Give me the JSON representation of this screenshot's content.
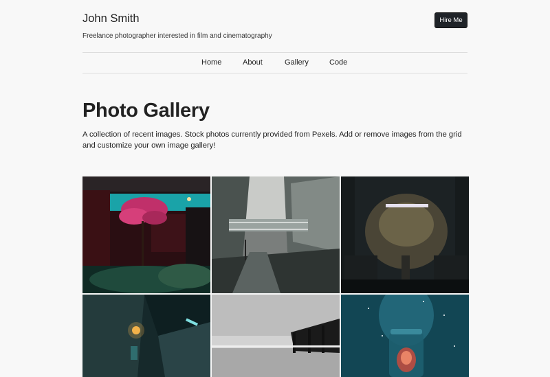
{
  "header": {
    "site_title": "John Smith",
    "tagline": "Freelance photographer interested in film and cinematography",
    "hire_button": "Hire Me"
  },
  "nav": {
    "items": [
      {
        "label": "Home"
      },
      {
        "label": "About"
      },
      {
        "label": "Gallery"
      },
      {
        "label": "Code"
      }
    ]
  },
  "main": {
    "title": "Photo Gallery",
    "intro": "A collection of recent images. Stock photos currently provided from Pexels. Add or remove images from the grid and customize your own image gallery!"
  },
  "colors": {
    "background": "#f8f8f8",
    "button_bg": "#1f2328",
    "divider": "#dddddd"
  }
}
